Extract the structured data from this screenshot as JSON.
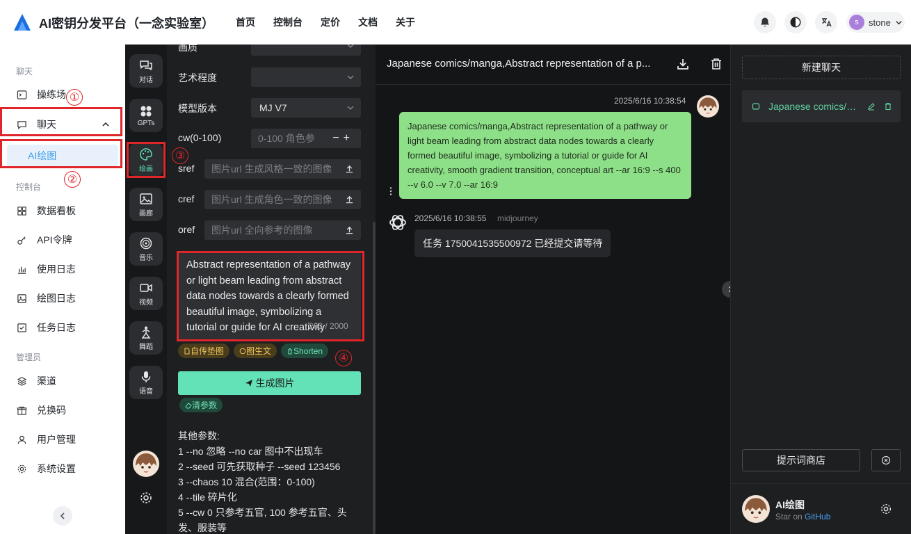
{
  "header": {
    "title": "AI密钥分发平台（一念实验室）",
    "nav": [
      "首页",
      "控制台",
      "定价",
      "文档",
      "关于"
    ],
    "user_initial": "s",
    "user_name": "stone"
  },
  "sidebar": {
    "section_chat": "聊天",
    "playground": "操练场",
    "chat": "聊天",
    "ai_draw": "AI绘图",
    "section_console": "控制台",
    "dashboard": "数据看板",
    "api_token": "API令牌",
    "usage_log": "使用日志",
    "draw_log": "绘图日志",
    "task_log": "任务日志",
    "section_admin": "管理员",
    "channel": "渠道",
    "redeem": "兑换码",
    "users": "用户管理",
    "settings": "系统设置"
  },
  "rail": {
    "chat": "对话",
    "gpts": "GPTs",
    "draw": "绘画",
    "gallery": "画廊",
    "music": "音乐",
    "video": "视频",
    "dance": "舞蹈",
    "voice": "语音"
  },
  "params": {
    "quality_label": "画质",
    "artistry_label": "艺术程度",
    "model_label": "模型版本",
    "model_value": "MJ V7",
    "cw_label": "cw(0-100)",
    "cw_placeholder": "0-100 角色参",
    "sref_label": "sref",
    "sref_placeholder": "图片url 生成风格一致的图像",
    "cref_label": "cref",
    "cref_placeholder": "图片url 生成角色一致的图像",
    "oref_label": "oref",
    "oref_placeholder": "图片url 全向参考的图像",
    "prompt": "Abstract representation of a pathway or light beam leading from abstract data nodes towards a clearly formed beautiful image, symbolizing a tutorial or guide for AI creativity",
    "prompt_count": "263 / 2000",
    "chip_pad": "自传垫图",
    "chip_img2txt": "图生文",
    "chip_shorten": "Shorten",
    "generate": "生成图片",
    "clear": "清参数",
    "other_title": "其他参数:",
    "other_lines": [
      "1 --no 忽略 --no car 图中不出现车",
      "2 --seed 可先获取种子 --seed 123456",
      "3 --chaos 10 混合(范围：0-100)",
      "4 --tile 碎片化",
      "5 --cw 0 只参考五官, 100 参考五官、头",
      "发、服装等"
    ]
  },
  "chat": {
    "title": "Japanese comics/manga,Abstract representation of a p...",
    "user_time": "2025/6/16 10:38:54",
    "user_message": "Japanese comics/manga,Abstract representation of a pathway or light beam leading from abstract data nodes towards a clearly formed beautiful image, symbolizing a tutorial or guide for AI creativity, smooth gradient transition, conceptual art --ar 16:9 --s 400 --v 6.0 --v 7.0 --ar 16:9",
    "bot_time": "2025/6/16 10:38:55",
    "bot_name": "midjourney",
    "bot_message": "任务 1750041535500972 已经提交请等待"
  },
  "right": {
    "new_chat": "新建聊天",
    "conv_title": "Japanese comics/manga,Abstract representation of a p...",
    "prompt_store": "提示词商店",
    "footer_name": "AI绘图",
    "footer_star": "Star on ",
    "footer_link": "GitHub"
  },
  "annotations": [
    "①",
    "②",
    "③",
    "④"
  ],
  "colors": {
    "accent_green": "#63e2b7",
    "annotation_red": "#e0262a",
    "user_bubble": "#8ee088",
    "sidebar_active": "#3a9ae8"
  }
}
